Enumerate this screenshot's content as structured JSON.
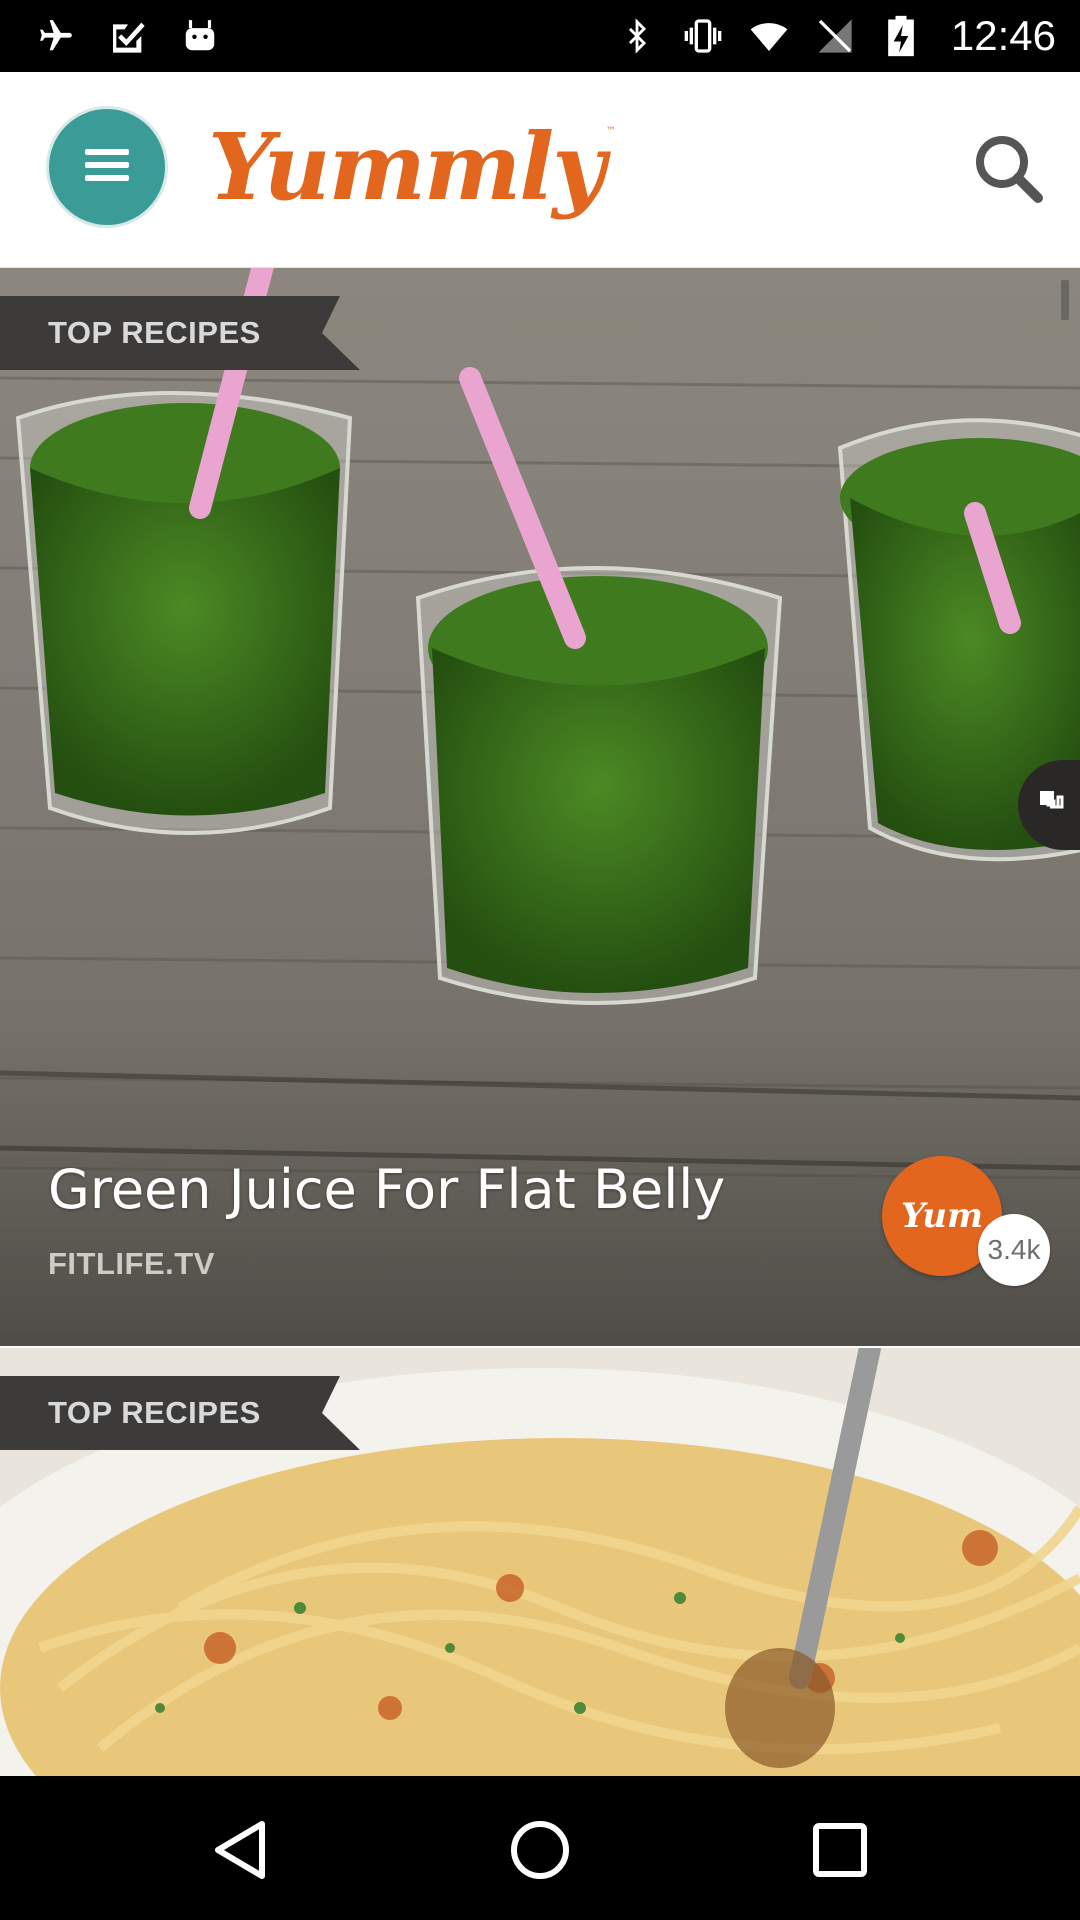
{
  "status_bar": {
    "time": "12:46",
    "icons_left": [
      "airplane-mode-icon",
      "task-check-icon",
      "android-icon"
    ],
    "icons_right": [
      "bluetooth-icon",
      "vibrate-icon",
      "wifi-icon",
      "no-signal-icon",
      "battery-charging-icon"
    ]
  },
  "header": {
    "menu_icon": "hamburger-menu-icon",
    "logo_text": "Yummly",
    "logo_tm": "™",
    "search_icon": "search-icon"
  },
  "feed": {
    "cards": [
      {
        "tag": "TOP RECIPES",
        "title": "Green Juice For Flat Belly",
        "source": "FITLIFE.TV",
        "yum_label": "Yum",
        "yum_count": "3.4k",
        "image": "green-smoothies-image"
      },
      {
        "tag": "TOP RECIPES",
        "image": "pasta-image"
      }
    ]
  },
  "nav_bar": {
    "buttons": [
      "back-icon",
      "home-icon",
      "recents-icon"
    ]
  },
  "colors": {
    "brand_orange": "#e2661d",
    "menu_teal": "#3a9b97",
    "tag_bg": "#3d3b3a"
  }
}
